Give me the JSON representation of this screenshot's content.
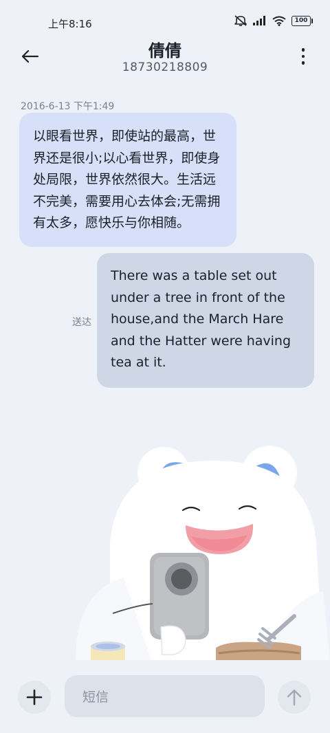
{
  "status": {
    "time": "上午8:16",
    "battery": "100"
  },
  "header": {
    "title": "倩倩",
    "phone": "18730218809"
  },
  "messages": [
    {
      "timestamp": "2016-6-13 下午1:49",
      "text": "以眼看世界，即使站的最高，世界还是很小;以心看世界，即使身处局限，世界依然很大。生活远不完美，需要用心去体会;无需拥有太多，愿快乐与你相随。",
      "direction": "incoming"
    },
    {
      "text": "There was a table set out under a tree in front of the house,and the March Hare and the Hatter were having tea at it.",
      "direction": "outgoing",
      "status": "送达"
    }
  ],
  "composer": {
    "placeholder": "短信"
  },
  "icons": {
    "back": "back-arrow-icon",
    "more": "more-vertical-icon",
    "add": "plus-icon",
    "send": "send-arrow-icon"
  },
  "colors": {
    "background": "#eef1f8",
    "incoming_bubble": "#d6e1f9",
    "outgoing_bubble": "#cfd6e6"
  }
}
